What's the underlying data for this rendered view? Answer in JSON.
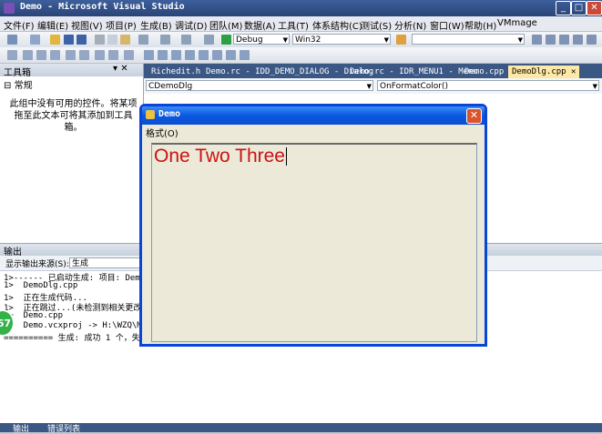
{
  "window": {
    "title": "Demo - Microsoft Visual Studio",
    "controls": [
      "minimize-icon",
      "maximize-icon",
      "close-icon"
    ]
  },
  "menu": [
    {
      "label": "文件(F)"
    },
    {
      "label": "编辑(E)"
    },
    {
      "label": "视图(V)"
    },
    {
      "label": "项目(P)"
    },
    {
      "label": "生成(B)"
    },
    {
      "label": "调试(D)"
    },
    {
      "label": "团队(M)"
    },
    {
      "label": "数据(A)"
    },
    {
      "label": "工具(T)"
    },
    {
      "label": "体系结构(C)"
    },
    {
      "label": "测试(S)"
    },
    {
      "label": "分析(N)"
    },
    {
      "label": "窗口(W)"
    },
    {
      "label": "帮助(H)"
    },
    {
      "label": "VMmage"
    }
  ],
  "toolbar": {
    "configuration": "Debug",
    "platform": "Win32",
    "find_value": ""
  },
  "toolbox": {
    "title": "工具箱",
    "section": "常规",
    "message": "此组中没有可用的控件。将某项拖至此文本可将其添加到工具箱。"
  },
  "tabs": [
    {
      "label": "Richedit.h",
      "active": false
    },
    {
      "label": "Demo.rc - IDD_DEMO_DIALOG - Dialog",
      "active": false
    },
    {
      "label": "Demo.rc - IDR_MENU1 - Menu",
      "active": false
    },
    {
      "label": "Demo.cpp",
      "active": false
    },
    {
      "label": "DemoDlg.cpp",
      "active": true
    }
  ],
  "code_nav": {
    "class_combo": "CDemoDlg",
    "member_combo": "OnFormatColor()"
  },
  "output": {
    "title": "输出",
    "source_label": "显示输出来源(S):",
    "source_value": "生成",
    "lines": [
      "1>------ 已启动生成: 项目: Demo, 配",
      "1>  DemoDlg.cpp",
      "1>  正在生成代码...",
      "1>  正在跳过...(未检测到相关更改)",
      "1>  Demo.cpp",
      "1>  Demo.vcxproj -> H:\\WZQ\\MFC_Step",
      "========== 生成: 成功 1 个，失败 0"
    ]
  },
  "status": {
    "tab1": "输出",
    "tab2": "错误列表"
  },
  "badge": "67",
  "dialog": {
    "title": "Demo",
    "menu_label": "格式(O)",
    "text": "One Two Three",
    "text_color": "#cc1111"
  },
  "colors": {
    "vs_titlebar": "#2a4478",
    "dialog_titlebar": "#0a58e0",
    "active_tab": "#fde8a6"
  }
}
